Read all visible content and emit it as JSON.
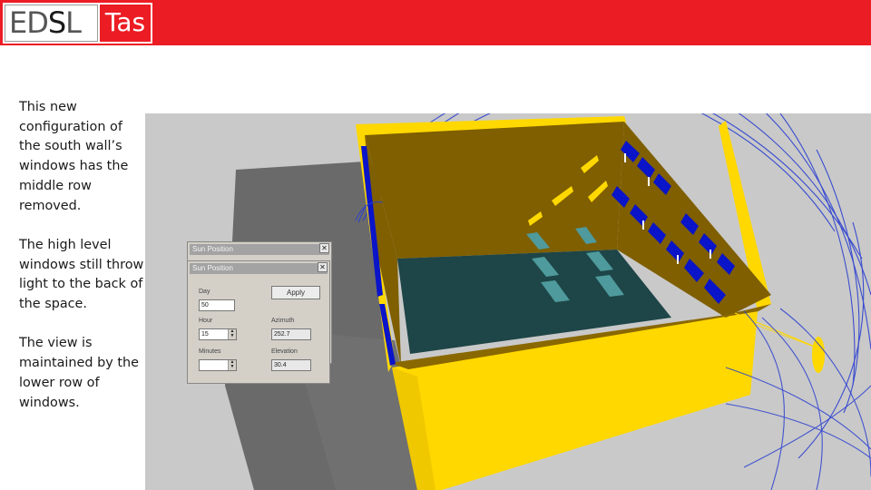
{
  "header": {
    "logo_edsl_prefix": "ED",
    "logo_edsl_s": "S",
    "logo_edsl_suffix": "L",
    "logo_tas": "Tas",
    "bar_color": "#ec1c24"
  },
  "description": {
    "paragraph1": "This new configuration of the south wall’s windows has the middle row removed.",
    "paragraph2": "The high level windows still throw light to the back of the space.",
    "paragraph3": "The view is maintained by the lower row of windows."
  },
  "sun_dialog_back": {
    "title": "Sun Position",
    "close": "✕"
  },
  "sun_dialog": {
    "title": "Sun Position",
    "close": "✕",
    "day_label": "Day",
    "day_value": "50",
    "apply_label": "Apply",
    "hour_label": "Hour",
    "hour_value": "15",
    "azimuth_label": "Azimuth",
    "azimuth_value": "252.7",
    "minutes_label": "Minutes",
    "minutes_value": "",
    "elevation_label": "Elevation",
    "elevation_value": "30.4"
  },
  "scene_colors": {
    "background": "#c9c9c9",
    "shadow": "#6a6a6a",
    "wall_yellow": "#ffd800",
    "wall_brown": "#7f5f00",
    "floor": "#1e4547",
    "sun_patch": "#4e9a9c",
    "glazing": "#0a14c8",
    "sky_dome": "#2a3fd0"
  }
}
